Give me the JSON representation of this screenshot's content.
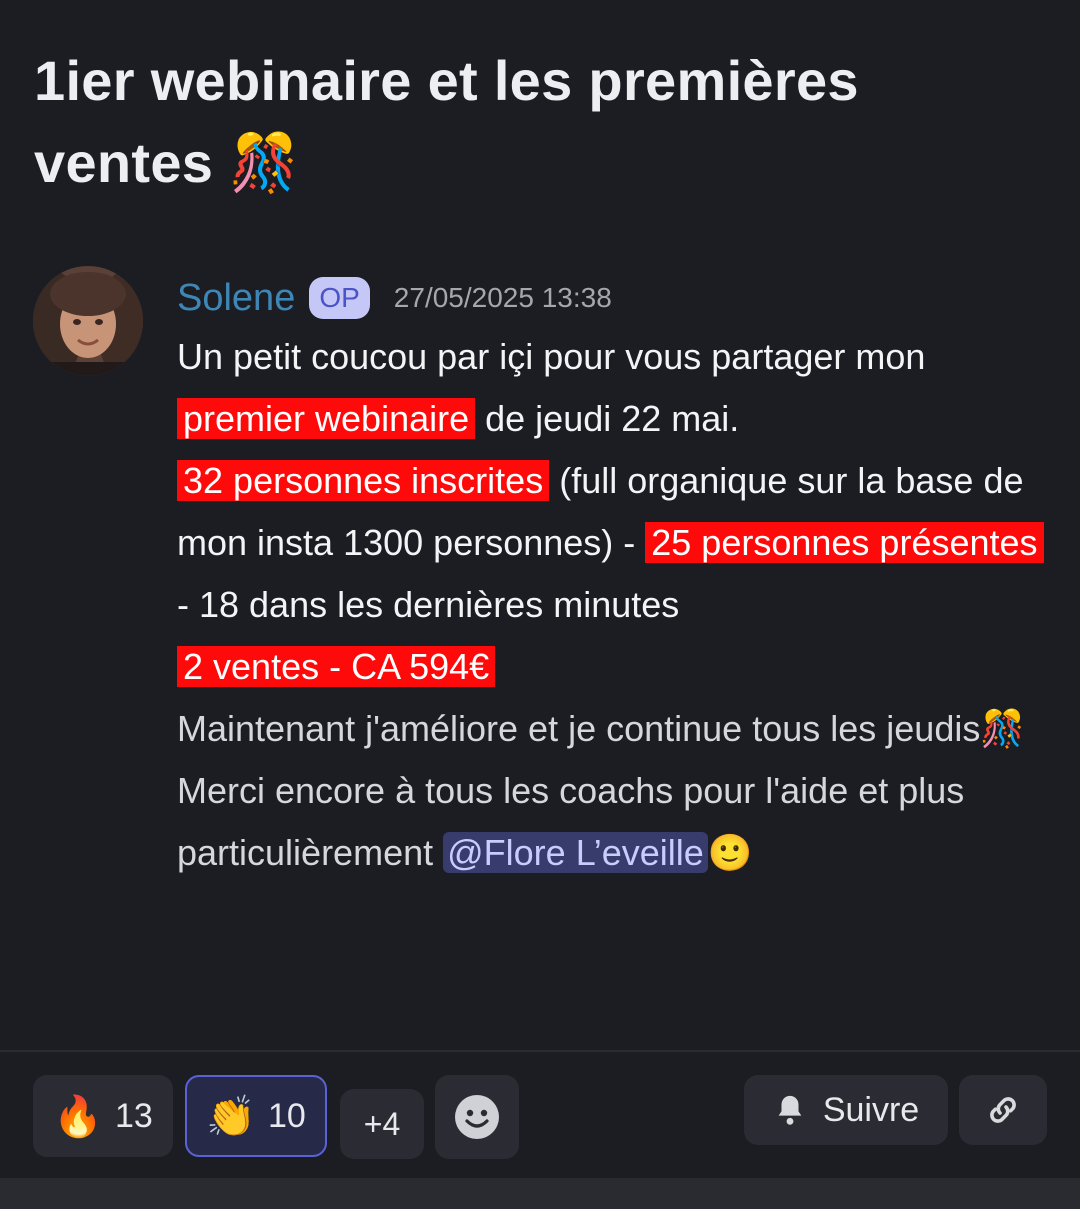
{
  "post": {
    "title": "1ier webinaire et les premières ventes 🎊",
    "author": "Solene",
    "badge": "OP",
    "timestamp": "27/05/2025 13:38"
  },
  "message": {
    "p1_a": "Un petit coucou par içi pour vous partager mon ",
    "p1_hl": "premier webinaire",
    "p1_b": " de jeudi 22 mai.",
    "p2_hl": "32 personnes inscrites",
    "p2_b": " (full organique sur la base de mon insta 1300 personnes) - ",
    "p2_hl2": "25 personnes présentes",
    "p2_c": " - 18 dans les dernières minutes",
    "p3_hl": "2 ventes - CA 594€",
    "p4": "Maintenant j'améliore et je continue tous les jeudis",
    "p4_emoji": "🎊",
    "p5_a": "Merci encore à tous les coachs pour l'aide et plus particulièrement ",
    "p5_mention": "@Flore L’eveille",
    "p5_emoji": "🙂"
  },
  "reactions": [
    {
      "emoji": "🔥",
      "count": "13"
    },
    {
      "emoji": "👏",
      "count": "10"
    }
  ],
  "more_reactions": "+4",
  "add_reaction_icon": "smiley-icon",
  "follow": {
    "label": "Suivre",
    "icon": "bell-icon"
  },
  "copy_link_icon": "link-icon",
  "colors": {
    "background": "#1c1d22",
    "highlight": "#ff0a0a",
    "author": "#3e86b5",
    "mention_bg": "#383c6c",
    "active_border": "#5b62d6"
  }
}
